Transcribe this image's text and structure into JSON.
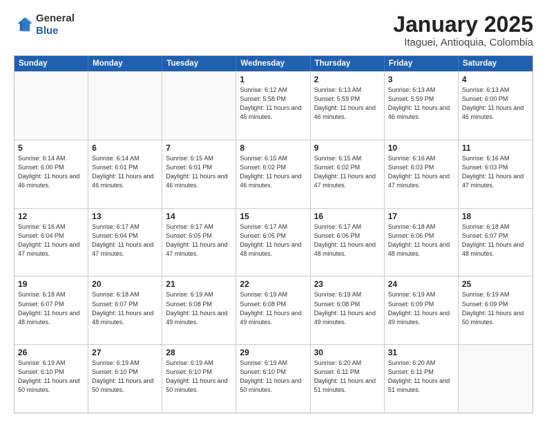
{
  "logo": {
    "general": "General",
    "blue": "Blue"
  },
  "title": "January 2025",
  "subtitle": "Itaguei, Antioquia, Colombia",
  "days": [
    "Sunday",
    "Monday",
    "Tuesday",
    "Wednesday",
    "Thursday",
    "Friday",
    "Saturday"
  ],
  "weeks": [
    [
      {
        "day": "",
        "info": ""
      },
      {
        "day": "",
        "info": ""
      },
      {
        "day": "",
        "info": ""
      },
      {
        "day": "1",
        "info": "Sunrise: 6:12 AM\nSunset: 5:58 PM\nDaylight: 11 hours and 46 minutes."
      },
      {
        "day": "2",
        "info": "Sunrise: 6:13 AM\nSunset: 5:59 PM\nDaylight: 11 hours and 46 minutes."
      },
      {
        "day": "3",
        "info": "Sunrise: 6:13 AM\nSunset: 5:59 PM\nDaylight: 11 hours and 46 minutes."
      },
      {
        "day": "4",
        "info": "Sunrise: 6:13 AM\nSunset: 6:00 PM\nDaylight: 11 hours and 46 minutes."
      }
    ],
    [
      {
        "day": "5",
        "info": "Sunrise: 6:14 AM\nSunset: 6:00 PM\nDaylight: 11 hours and 46 minutes."
      },
      {
        "day": "6",
        "info": "Sunrise: 6:14 AM\nSunset: 6:01 PM\nDaylight: 11 hours and 46 minutes."
      },
      {
        "day": "7",
        "info": "Sunrise: 6:15 AM\nSunset: 6:01 PM\nDaylight: 11 hours and 46 minutes."
      },
      {
        "day": "8",
        "info": "Sunrise: 6:15 AM\nSunset: 6:02 PM\nDaylight: 11 hours and 46 minutes."
      },
      {
        "day": "9",
        "info": "Sunrise: 6:15 AM\nSunset: 6:02 PM\nDaylight: 11 hours and 47 minutes."
      },
      {
        "day": "10",
        "info": "Sunrise: 6:16 AM\nSunset: 6:03 PM\nDaylight: 11 hours and 47 minutes."
      },
      {
        "day": "11",
        "info": "Sunrise: 6:16 AM\nSunset: 6:03 PM\nDaylight: 11 hours and 47 minutes."
      }
    ],
    [
      {
        "day": "12",
        "info": "Sunrise: 6:16 AM\nSunset: 6:04 PM\nDaylight: 11 hours and 47 minutes."
      },
      {
        "day": "13",
        "info": "Sunrise: 6:17 AM\nSunset: 6:04 PM\nDaylight: 11 hours and 47 minutes."
      },
      {
        "day": "14",
        "info": "Sunrise: 6:17 AM\nSunset: 6:05 PM\nDaylight: 11 hours and 47 minutes."
      },
      {
        "day": "15",
        "info": "Sunrise: 6:17 AM\nSunset: 6:05 PM\nDaylight: 11 hours and 48 minutes."
      },
      {
        "day": "16",
        "info": "Sunrise: 6:17 AM\nSunset: 6:06 PM\nDaylight: 11 hours and 48 minutes."
      },
      {
        "day": "17",
        "info": "Sunrise: 6:18 AM\nSunset: 6:06 PM\nDaylight: 11 hours and 48 minutes."
      },
      {
        "day": "18",
        "info": "Sunrise: 6:18 AM\nSunset: 6:07 PM\nDaylight: 11 hours and 48 minutes."
      }
    ],
    [
      {
        "day": "19",
        "info": "Sunrise: 6:18 AM\nSunset: 6:07 PM\nDaylight: 11 hours and 48 minutes."
      },
      {
        "day": "20",
        "info": "Sunrise: 6:18 AM\nSunset: 6:07 PM\nDaylight: 11 hours and 48 minutes."
      },
      {
        "day": "21",
        "info": "Sunrise: 6:19 AM\nSunset: 6:08 PM\nDaylight: 11 hours and 49 minutes."
      },
      {
        "day": "22",
        "info": "Sunrise: 6:19 AM\nSunset: 6:08 PM\nDaylight: 11 hours and 49 minutes."
      },
      {
        "day": "23",
        "info": "Sunrise: 6:19 AM\nSunset: 6:08 PM\nDaylight: 11 hours and 49 minutes."
      },
      {
        "day": "24",
        "info": "Sunrise: 6:19 AM\nSunset: 6:09 PM\nDaylight: 11 hours and 49 minutes."
      },
      {
        "day": "25",
        "info": "Sunrise: 6:19 AM\nSunset: 6:09 PM\nDaylight: 11 hours and 50 minutes."
      }
    ],
    [
      {
        "day": "26",
        "info": "Sunrise: 6:19 AM\nSunset: 6:10 PM\nDaylight: 11 hours and 50 minutes."
      },
      {
        "day": "27",
        "info": "Sunrise: 6:19 AM\nSunset: 6:10 PM\nDaylight: 11 hours and 50 minutes."
      },
      {
        "day": "28",
        "info": "Sunrise: 6:19 AM\nSunset: 6:10 PM\nDaylight: 11 hours and 50 minutes."
      },
      {
        "day": "29",
        "info": "Sunrise: 6:19 AM\nSunset: 6:10 PM\nDaylight: 11 hours and 50 minutes."
      },
      {
        "day": "30",
        "info": "Sunrise: 6:20 AM\nSunset: 6:11 PM\nDaylight: 11 hours and 51 minutes."
      },
      {
        "day": "31",
        "info": "Sunrise: 6:20 AM\nSunset: 6:11 PM\nDaylight: 11 hours and 51 minutes."
      },
      {
        "day": "",
        "info": ""
      }
    ]
  ]
}
